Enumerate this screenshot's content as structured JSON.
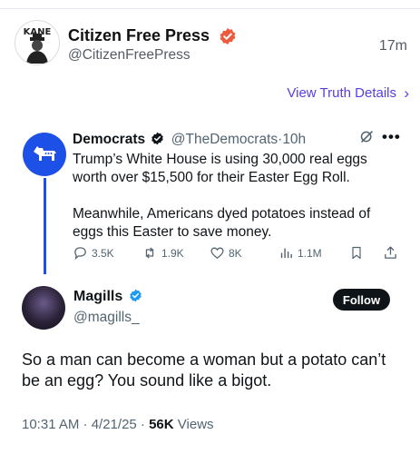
{
  "source": {
    "name": "Citizen Free Press",
    "handle": "@CitizenFreePress",
    "time": "17m",
    "logo_text": "KANE"
  },
  "truth_link": {
    "label": "View Truth Details",
    "chevron": "›"
  },
  "quoted_post": {
    "name": "Democrats",
    "handle": "@TheDemocrats",
    "separator": "·",
    "time": "10h",
    "body": [
      "Trump’s White House is using 30,000 real eggs worth over $15,500 for their Easter Egg Roll.",
      "Meanwhile, Americans dyed potatoes instead of eggs this Easter to save money."
    ],
    "stats": {
      "replies": "3.5K",
      "reposts": "1.9K",
      "likes": "8K",
      "views": "1.1M"
    }
  },
  "reply_post": {
    "name": "Magills",
    "handle": "@magills_",
    "follow_label": "Follow",
    "text": "So a man can become a woman but a potato can’t be an egg? You sound like a bigot.",
    "date": "10:31 AM · 4/21/25 · ",
    "views_count": "56K",
    "views_label": " Views"
  },
  "colors": {
    "verified_orange": "#f05a3c",
    "verified_blue": "#1d9bf0",
    "dem_blue": "#1d50e6",
    "link_purple": "#5a3ce0"
  },
  "icons": [
    "verified-badge-icon",
    "donkey-icon",
    "grok-icon",
    "more-icon",
    "reply-icon",
    "repost-icon",
    "like-icon",
    "views-icon",
    "bookmark-icon",
    "share-icon"
  ]
}
